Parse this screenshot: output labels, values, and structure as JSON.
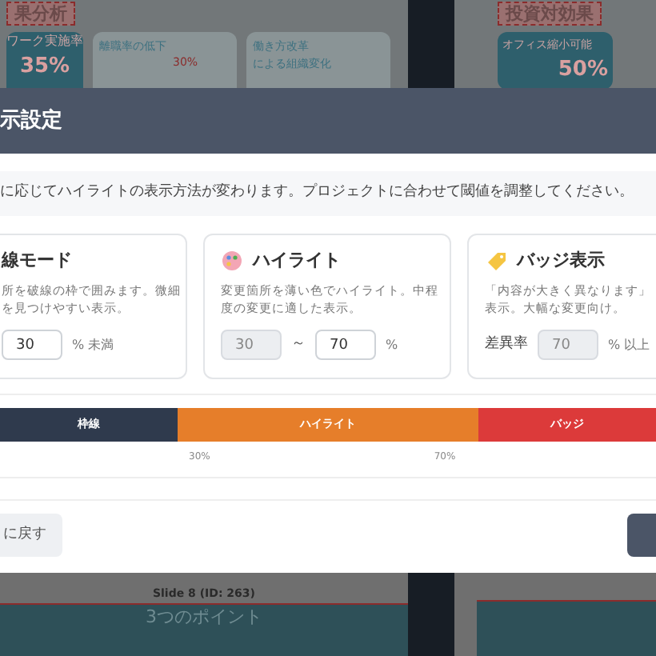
{
  "background": {
    "left_slide": {
      "title": "果分析",
      "stat_card": {
        "label": "ワーク実施率",
        "value": "35%"
      },
      "cards": [
        {
          "title": "離職率の低下",
          "value": "30%"
        },
        {
          "title_lines": [
            "働き方改革",
            "による組織変化"
          ]
        }
      ]
    },
    "right_slide": {
      "title": "投資対効果",
      "stat_card": {
        "label": "オフィス縮小可能",
        "value": "50%"
      }
    },
    "bottom_slide": {
      "caption": "Slide 8 (ID: 263)",
      "heading": "3つのポイント"
    }
  },
  "modal": {
    "title": "示設定",
    "description": "に応じてハイライトの表示方法が変わります。プロジェクトに合わせて閾値を調整してください。",
    "modes": [
      {
        "kind": "border",
        "title": "線モード",
        "description_lines": [
          "所を破線の枠で囲みます。微細",
          "を見つけやすい表示。"
        ],
        "inputs": [
          {
            "value": "30",
            "disabled": false
          }
        ],
        "suffix": "% 未満"
      },
      {
        "kind": "highlight",
        "title": "ハイライト",
        "description_lines": [
          "変更箇所を薄い色でハイライト。中程",
          "度の変更に適した表示。"
        ],
        "inputs": [
          {
            "value": "30",
            "disabled": true
          },
          {
            "value": "70",
            "disabled": false
          }
        ],
        "separator": "～",
        "suffix": "%"
      },
      {
        "kind": "badge",
        "title": "バッジ表示",
        "description_lines": [
          "「内容が大きく異なります」",
          "表示。大幅な変更向け。"
        ],
        "prefix": "差異率",
        "inputs": [
          {
            "value": "70",
            "disabled": true
          }
        ],
        "suffix": "% 以上"
      }
    ],
    "scale": {
      "segments": [
        {
          "label": "枠線",
          "color": "#2f3a4d"
        },
        {
          "label": "ハイライト",
          "color": "#e67e2a"
        },
        {
          "label": "バッジ",
          "color": "#dc3a3a"
        }
      ],
      "ticks": [
        "30%",
        "70%"
      ]
    },
    "footer": {
      "reset_button": "に戻す"
    }
  }
}
